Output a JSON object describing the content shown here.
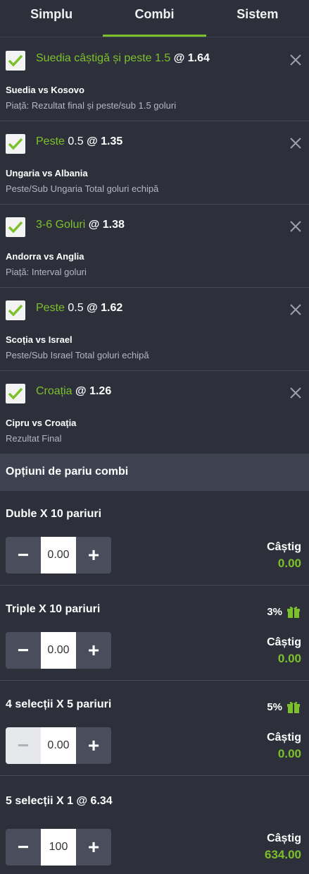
{
  "tabs": [
    {
      "label": "Simplu"
    },
    {
      "label": "Combi"
    },
    {
      "label": "Sistem"
    }
  ],
  "selections": [
    {
      "pick": "Suedia câștigă și peste 1.5",
      "pick_extra": "",
      "odds": "@ 1.64",
      "match": "Suedia vs Kosovo",
      "market": "Piață: Rezultat final și peste/sub 1.5 goluri"
    },
    {
      "pick": "Peste",
      "pick_extra": " 0.5",
      "odds": "@ 1.35",
      "match": "Ungaria vs Albania",
      "market": "Peste/Sub Ungaria Total goluri echipă"
    },
    {
      "pick": "3-6 Goluri",
      "pick_extra": "",
      "odds": "@ 1.38",
      "match": "Andorra vs Anglia",
      "market": "Piață: Interval goluri"
    },
    {
      "pick": "Peste",
      "pick_extra": " 0.5",
      "odds": "@ 1.62",
      "match": "Scoția vs Israel",
      "market": "Peste/Sub Israel Total goluri echipă"
    },
    {
      "pick": "Croația",
      "pick_extra": "",
      "odds": "@ 1.26",
      "match": "Cipru vs Croația",
      "market": "Rezultat Final"
    }
  ],
  "options_header": "Opțiuni de pariu combi",
  "options": [
    {
      "label": "Duble X  10 pariuri",
      "stake": "0.00",
      "win_label": "Câștig",
      "win_value": "0.00",
      "bonus": ""
    },
    {
      "label": "Triple X  10 pariuri",
      "stake": "0.00",
      "win_label": "Câștig",
      "win_value": "0.00",
      "bonus": "3%"
    },
    {
      "label": "4 selecții X  5 pariuri",
      "stake": "0.00",
      "win_label": "Câștig",
      "win_value": "0.00",
      "bonus": "5%"
    },
    {
      "label": "5 selecții X  1 @  6.34",
      "stake": "100",
      "win_label": "Câștig",
      "win_value": "634.00",
      "bonus": ""
    }
  ],
  "stepper": {
    "minus": "−",
    "plus": "+"
  },
  "colors": {
    "accent": "#7cc12b",
    "background": "#2d2f3b",
    "header": "#3e4150"
  }
}
